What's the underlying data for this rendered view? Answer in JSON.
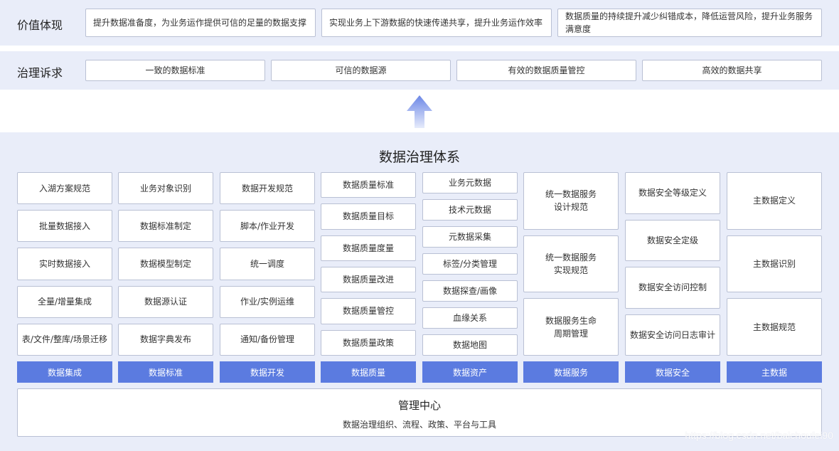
{
  "value": {
    "title": "价值体现",
    "items": [
      "提升数据准备度，为业务运作提供可信的足量的数据支撑",
      "实现业务上下游数据的快速传递共享，提升业务运作效率",
      "数据质量的持续提升减少纠错成本，降低运营风险，提升业务服务满意度"
    ]
  },
  "demand": {
    "title": "治理诉求",
    "items": [
      "一致的数据标准",
      "可信的数据源",
      "有效的数据质量管控",
      "高效的数据共享"
    ]
  },
  "arrow": {
    "icon": "up-arrow-icon",
    "color": "#6c87e6"
  },
  "system": {
    "title": "数据治理体系",
    "columns": [
      {
        "label": "数据集成",
        "items": [
          "入湖方案规范",
          "批量数据接入",
          "实时数据接入",
          "全量/增量集成",
          "表/文件/整库/场景迁移"
        ]
      },
      {
        "label": "数据标准",
        "items": [
          "业务对象识别",
          "数据标准制定",
          "数据模型制定",
          "数据源认证",
          "数据字典发布"
        ]
      },
      {
        "label": "数据开发",
        "items": [
          "数据开发规范",
          "脚本/作业开发",
          "统一调度",
          "作业/实例运维",
          "通知/备份管理"
        ]
      },
      {
        "label": "数据质量",
        "items": [
          "数据质量标准",
          "数据质量目标",
          "数据质量度量",
          "数据质量改进",
          "数据质量管控",
          "数据质量政策"
        ]
      },
      {
        "label": "数据资产",
        "items": [
          "业务元数据",
          "技术元数据",
          "元数据采集",
          "标签/分类管理",
          "数据探查/画像",
          "血缘关系",
          "数据地图"
        ]
      },
      {
        "label": "数据服务",
        "items": [
          "统一数据服务\n设计规范",
          "统一数据服务\n实现规范",
          "数据服务生命\n周期管理"
        ]
      },
      {
        "label": "数据安全",
        "items": [
          "数据安全等级定义",
          "数据安全定级",
          "数据安全访问控制",
          "数据安全访问日志审计"
        ]
      },
      {
        "label": "主数据",
        "items": [
          "主数据定义",
          "主数据识别",
          "主数据规范"
        ]
      }
    ]
  },
  "management": {
    "title": "管理中心",
    "subtitle": "数据治理组织、流程、政策、平台与工具"
  },
  "watermark": "https://blog.csdn.net/baichoufei90",
  "colors": {
    "band": "#e9edf9",
    "label_bg": "#5b7be0",
    "border": "#b9c0d4"
  }
}
